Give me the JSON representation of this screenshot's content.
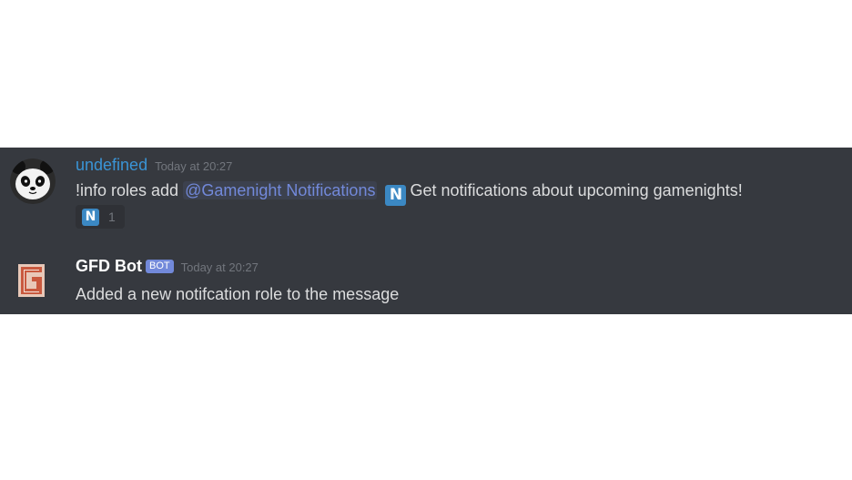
{
  "messages": [
    {
      "username": "undefined",
      "timestamp": "Today at 20:27",
      "content": {
        "command": "!info roles add",
        "mention": "@Gamenight Notifications",
        "emoji": "N",
        "text": "Get notifications about upcoming gamenights!"
      },
      "reaction": {
        "emoji": "N",
        "count": "1"
      },
      "avatar_icon": "panda-avatar-icon"
    },
    {
      "username": "GFD Bot",
      "bot_tag": "BOT",
      "timestamp": "Today at 20:27",
      "content": {
        "text": "Added a new notifcation role to the message"
      },
      "avatar_icon": "gfd-logo-icon"
    }
  ],
  "colors": {
    "background": "#36393f",
    "username_blue": "#3a94d6",
    "mention": "#7289da",
    "bot_tag": "#7289da",
    "emoji_n": "#3b88c3",
    "timestamp": "#72767d",
    "text": "#dcddde"
  }
}
